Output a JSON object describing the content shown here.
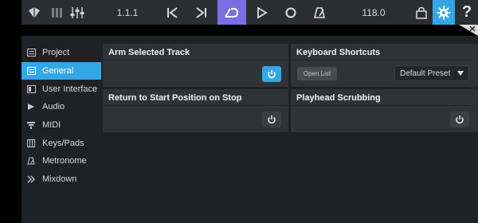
{
  "toolbar": {
    "position": "1.1.1",
    "tempo": "118.0",
    "icons": [
      "file-icon",
      "meter-icon",
      "mixer-icon",
      "skip-back-icon",
      "skip-forward-icon",
      "loop-icon",
      "play-icon",
      "record-icon",
      "metronome-icon",
      "store-icon",
      "gear-icon",
      "help-icon"
    ]
  },
  "sidebar": {
    "items": [
      {
        "label": "Project",
        "icon": "project-icon"
      },
      {
        "label": "General",
        "icon": "general-icon",
        "active": true
      },
      {
        "label": "User Interface",
        "icon": "ui-icon"
      },
      {
        "label": "Audio",
        "icon": "audio-icon"
      },
      {
        "label": "MIDI",
        "icon": "midi-icon"
      },
      {
        "label": "Keys/Pads",
        "icon": "keys-icon"
      },
      {
        "label": "Metronome",
        "icon": "metronome-icon"
      },
      {
        "label": "Mixdown",
        "icon": "mixdown-icon"
      }
    ]
  },
  "panels": {
    "arm": {
      "title": "Arm Selected Track",
      "enabled": true
    },
    "keyboard": {
      "title": "Keyboard Shortcuts",
      "open_list_label": "Open List",
      "preset": "Default Preset"
    },
    "return": {
      "title": "Return to Start Position on Stop",
      "enabled": false
    },
    "scrub": {
      "title": "Playhead Scrubbing",
      "enabled": false
    }
  },
  "colors": {
    "accent": "#33a7e6",
    "loop": "#7b6fe0",
    "toolbar_bg": "#2b2e33",
    "panel_bg": "#2f3338",
    "main_bg": "#1e2125"
  }
}
